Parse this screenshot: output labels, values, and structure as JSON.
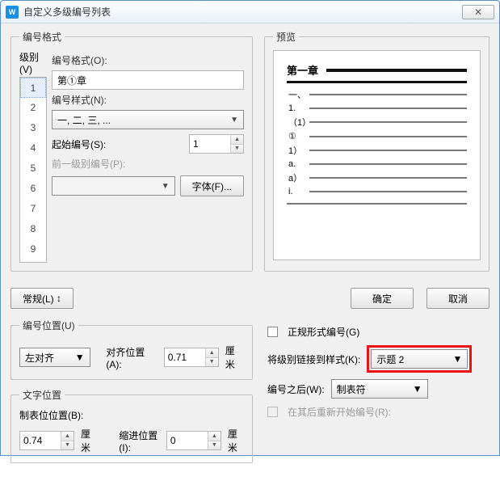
{
  "window": {
    "title": "自定义多级编号列表",
    "close_glyph": "✕"
  },
  "groups": {
    "format": "编号格式",
    "preview": "预览",
    "num_position": "编号位置(U)",
    "text_position": "文字位置"
  },
  "labels": {
    "level": "级别(V)",
    "num_format": "编号格式(O):",
    "num_style": "编号样式(N):",
    "start_at": "起始编号(S):",
    "prev_level": "前一级别编号(P):",
    "font_btn": "字体(F)...",
    "general_btn": "常规(L)",
    "ok": "确定",
    "cancel": "取消",
    "align_pos": "对齐位置(A):",
    "tab_pos": "制表位位置(B):",
    "indent_pos": "缩进位置(I):",
    "unit": "厘米",
    "formal_numbering": "正规形式编号(G)",
    "link_style": "将级别链接到样式(K):",
    "after_number": "编号之后(W):",
    "restart_after": "在其后重新开始编号(R):"
  },
  "values": {
    "levels": [
      "1",
      "2",
      "3",
      "4",
      "5",
      "6",
      "7",
      "8",
      "9"
    ],
    "selected_level": "1",
    "num_format_value": "第①章",
    "num_style_value": "一, 二, 三, ...",
    "start_at_value": "1",
    "alignment": "左对齐",
    "align_pos_value": "0.71",
    "tab_pos_value": "0.74",
    "indent_pos_value": "0",
    "link_style_value": "示题 2",
    "after_number_value": "制表符",
    "general_arrow": "↕"
  },
  "preview": {
    "heading": "第一章",
    "lines": [
      "一、",
      "1.",
      "（1）",
      "①",
      "1）",
      "a.",
      "a）",
      "i."
    ]
  }
}
